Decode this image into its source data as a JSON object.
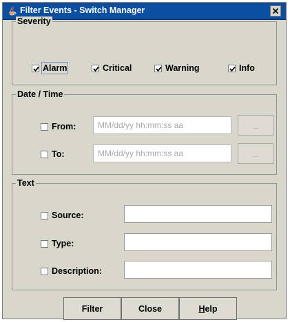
{
  "window": {
    "title": "Filter Events - Switch Manager"
  },
  "severity": {
    "legend": "Severity",
    "options": [
      {
        "label": "Alarm",
        "checked": true
      },
      {
        "label": "Critical",
        "checked": true
      },
      {
        "label": "Warning",
        "checked": true
      },
      {
        "label": "Info",
        "checked": true
      }
    ]
  },
  "datetime": {
    "legend": "Date / Time",
    "from": {
      "label": "From:",
      "checked": false,
      "placeholder": "MM/dd/yy hh:mm:ss aa",
      "browse_label": "..."
    },
    "to": {
      "label": "To:",
      "checked": false,
      "placeholder": "MM/dd/yy hh:mm:ss aa",
      "browse_label": "..."
    }
  },
  "text": {
    "legend": "Text",
    "source": {
      "label": "Source:",
      "checked": false,
      "value": ""
    },
    "type": {
      "label": "Type:",
      "checked": false,
      "value": ""
    },
    "description": {
      "label": "Description:",
      "checked": false,
      "value": ""
    }
  },
  "buttons": {
    "filter": "Filter",
    "close": "Close",
    "help_mnemonic": "H",
    "help_rest": "elp"
  },
  "icons": {
    "app": "java-cup-icon",
    "close": "close-icon",
    "check": "check-icon"
  },
  "colors": {
    "titlebar": "#0b4fa3",
    "dialog_bg": "#d9d6cc"
  }
}
